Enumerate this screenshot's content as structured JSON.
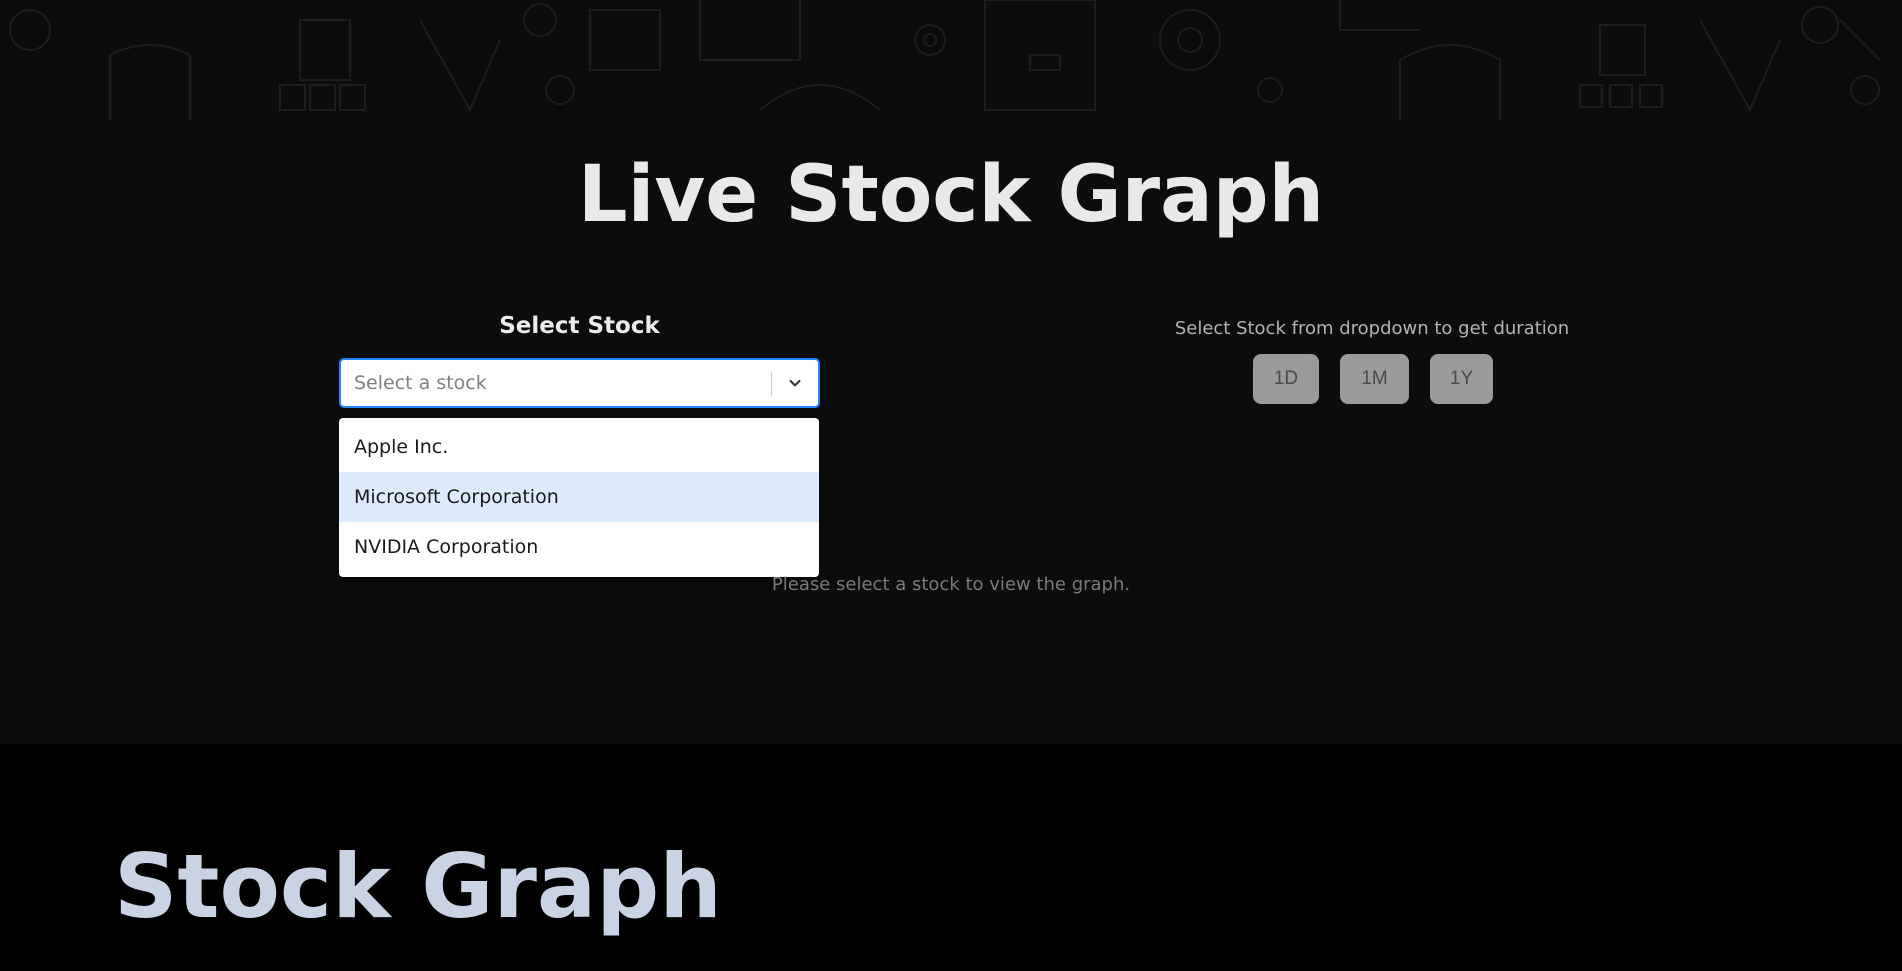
{
  "header": {
    "title": "Live Stock Graph"
  },
  "stock_select": {
    "label": "Select Stock",
    "placeholder": "Select a stock",
    "options": [
      "Apple Inc.",
      "Microsoft Corporation",
      "NVIDIA Corporation"
    ],
    "highlighted_option": "Microsoft Corporation"
  },
  "duration": {
    "hint": "Select Stock from dropdown to get duration",
    "buttons": [
      "1D",
      "1M",
      "1Y"
    ]
  },
  "graph": {
    "empty_message": "Please select a stock to view the graph."
  },
  "section2": {
    "title": "Stock Graph"
  },
  "colors": {
    "accent": "#2684ff",
    "option_highlight": "#deebff",
    "disabled_button": "#9a9a9a",
    "bottom_title": "#c9d3e4"
  },
  "icons": {
    "dropdown": "chevron-down-icon"
  }
}
